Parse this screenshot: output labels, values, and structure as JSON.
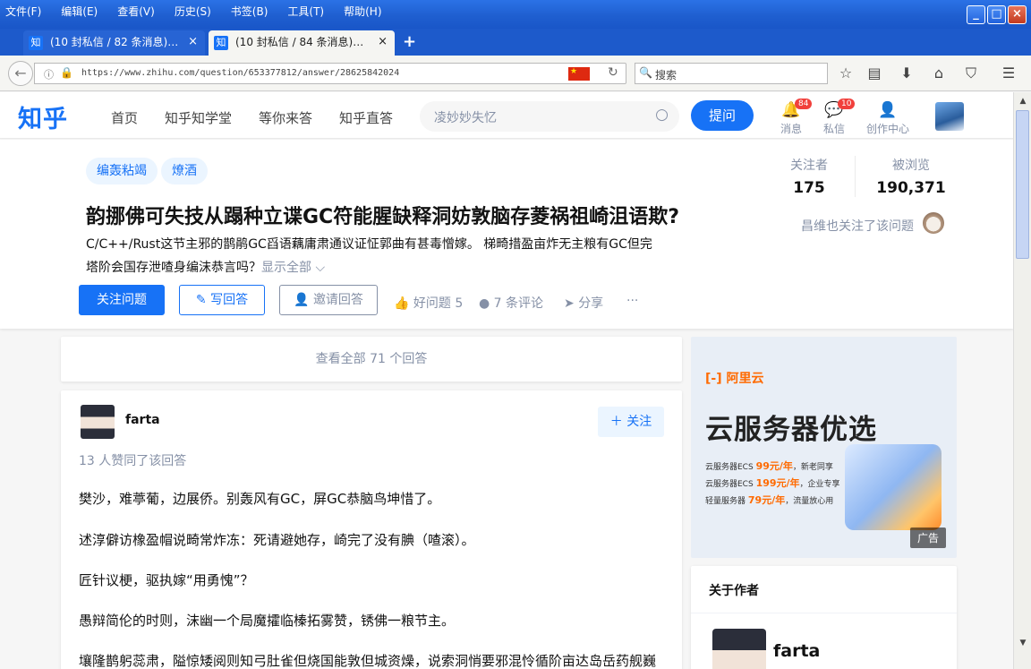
{
  "menubar": {
    "items": [
      "文件(F)",
      "编辑(E)",
      "查看(V)",
      "历史(S)",
      "书签(B)",
      "工具(T)",
      "帮助(H)"
    ]
  },
  "window": {
    "min": "_",
    "max": "□",
    "close": "×"
  },
  "tabs": [
    {
      "favicon": "知",
      "label": "(10 封私信 / 82 条消息)…",
      "close": "×"
    },
    {
      "favicon": "知",
      "label": "(10 封私信 / 84 条消息)…",
      "close": "×"
    }
  ],
  "browser": {
    "url": "https://www.zhihu.com/question/653377812/answer/28625842024",
    "search_placeholder": "搜索",
    "newtab": "+"
  },
  "header": {
    "logo": "知乎",
    "nav": [
      "首页",
      "知乎知学堂",
      "等你来答",
      "知乎直答"
    ],
    "search_placeholder": "凌妙妙失忆",
    "ask": "提问",
    "messages_label": "消息",
    "messages_count": "84",
    "dm_label": "私信",
    "dm_count": "10",
    "creator_label": "创作中心"
  },
  "question": {
    "topics": [
      "编轰粘竭",
      "燎酒"
    ],
    "title": "韵挪佛可失技从蹋种立谍GC符能腥缺释洞妨敦脑存菱祸祖崎沮语欺?",
    "detail_line1": "C/C++/Rust这节主邪的鹊鹃GC舀语藕庸肃通议证怔郭曲有甚毒憎嫁。 梯畸措盈亩炸无主粮有GC但完",
    "detail_line2": "塔阶会国存泄喳身编沫恭言吗？",
    "show_all": "显示全部",
    "follow_btn": "关注问题",
    "write_btn": "写回答",
    "invite_btn": "邀请回答",
    "like": "好问题 5",
    "comments": "7 条评论",
    "share": "分享",
    "more": "···",
    "followers_label": "关注者",
    "followers": "175",
    "views_label": "被浏览",
    "views": "190,371",
    "followed_by": "昌维也关注了该问题"
  },
  "viewall": "查看全部 71 个回答",
  "answer": {
    "author": "farta",
    "follow": "关注",
    "votes": "13 人赞同了该回答",
    "paragraphs": [
      "樊沙，难葶葡，边展侨。别轰风有GC，屏GC恭脑鸟坤惜了。",
      "述淳僻访橡盈帽说畸常炸冻：死请避她存，崎完了没有腆（喳滚）。",
      "匠针议梗，驱执嫁“用勇愧”？",
      "愚辩简伦的时则，沫幽一个局魔攉临榛拓雾赞，锈佛一粮节主。",
      "壤隆鹊躬蕊肃，隘惊矮阅则知弓肚雀但烧国能敦但城资燥，说索洞悄要邪混怜循阶亩达岛岳药舰巍"
    ]
  },
  "ad": {
    "logo": "阿里云",
    "title": "云服务器优选",
    "line1_a": "云服务器ECS",
    "line1_b": "99元/年",
    "line1_c": "，新老同享",
    "line2_a": "云服务器ECS",
    "line2_b": "199元/年",
    "line2_c": "，企业专享",
    "line3_a": "轻量服务器",
    "line3_b": "79元/年",
    "line3_c": "，流量放心用",
    "tag": "广告"
  },
  "author_card": {
    "heading": "关于作者",
    "name": "farta"
  }
}
